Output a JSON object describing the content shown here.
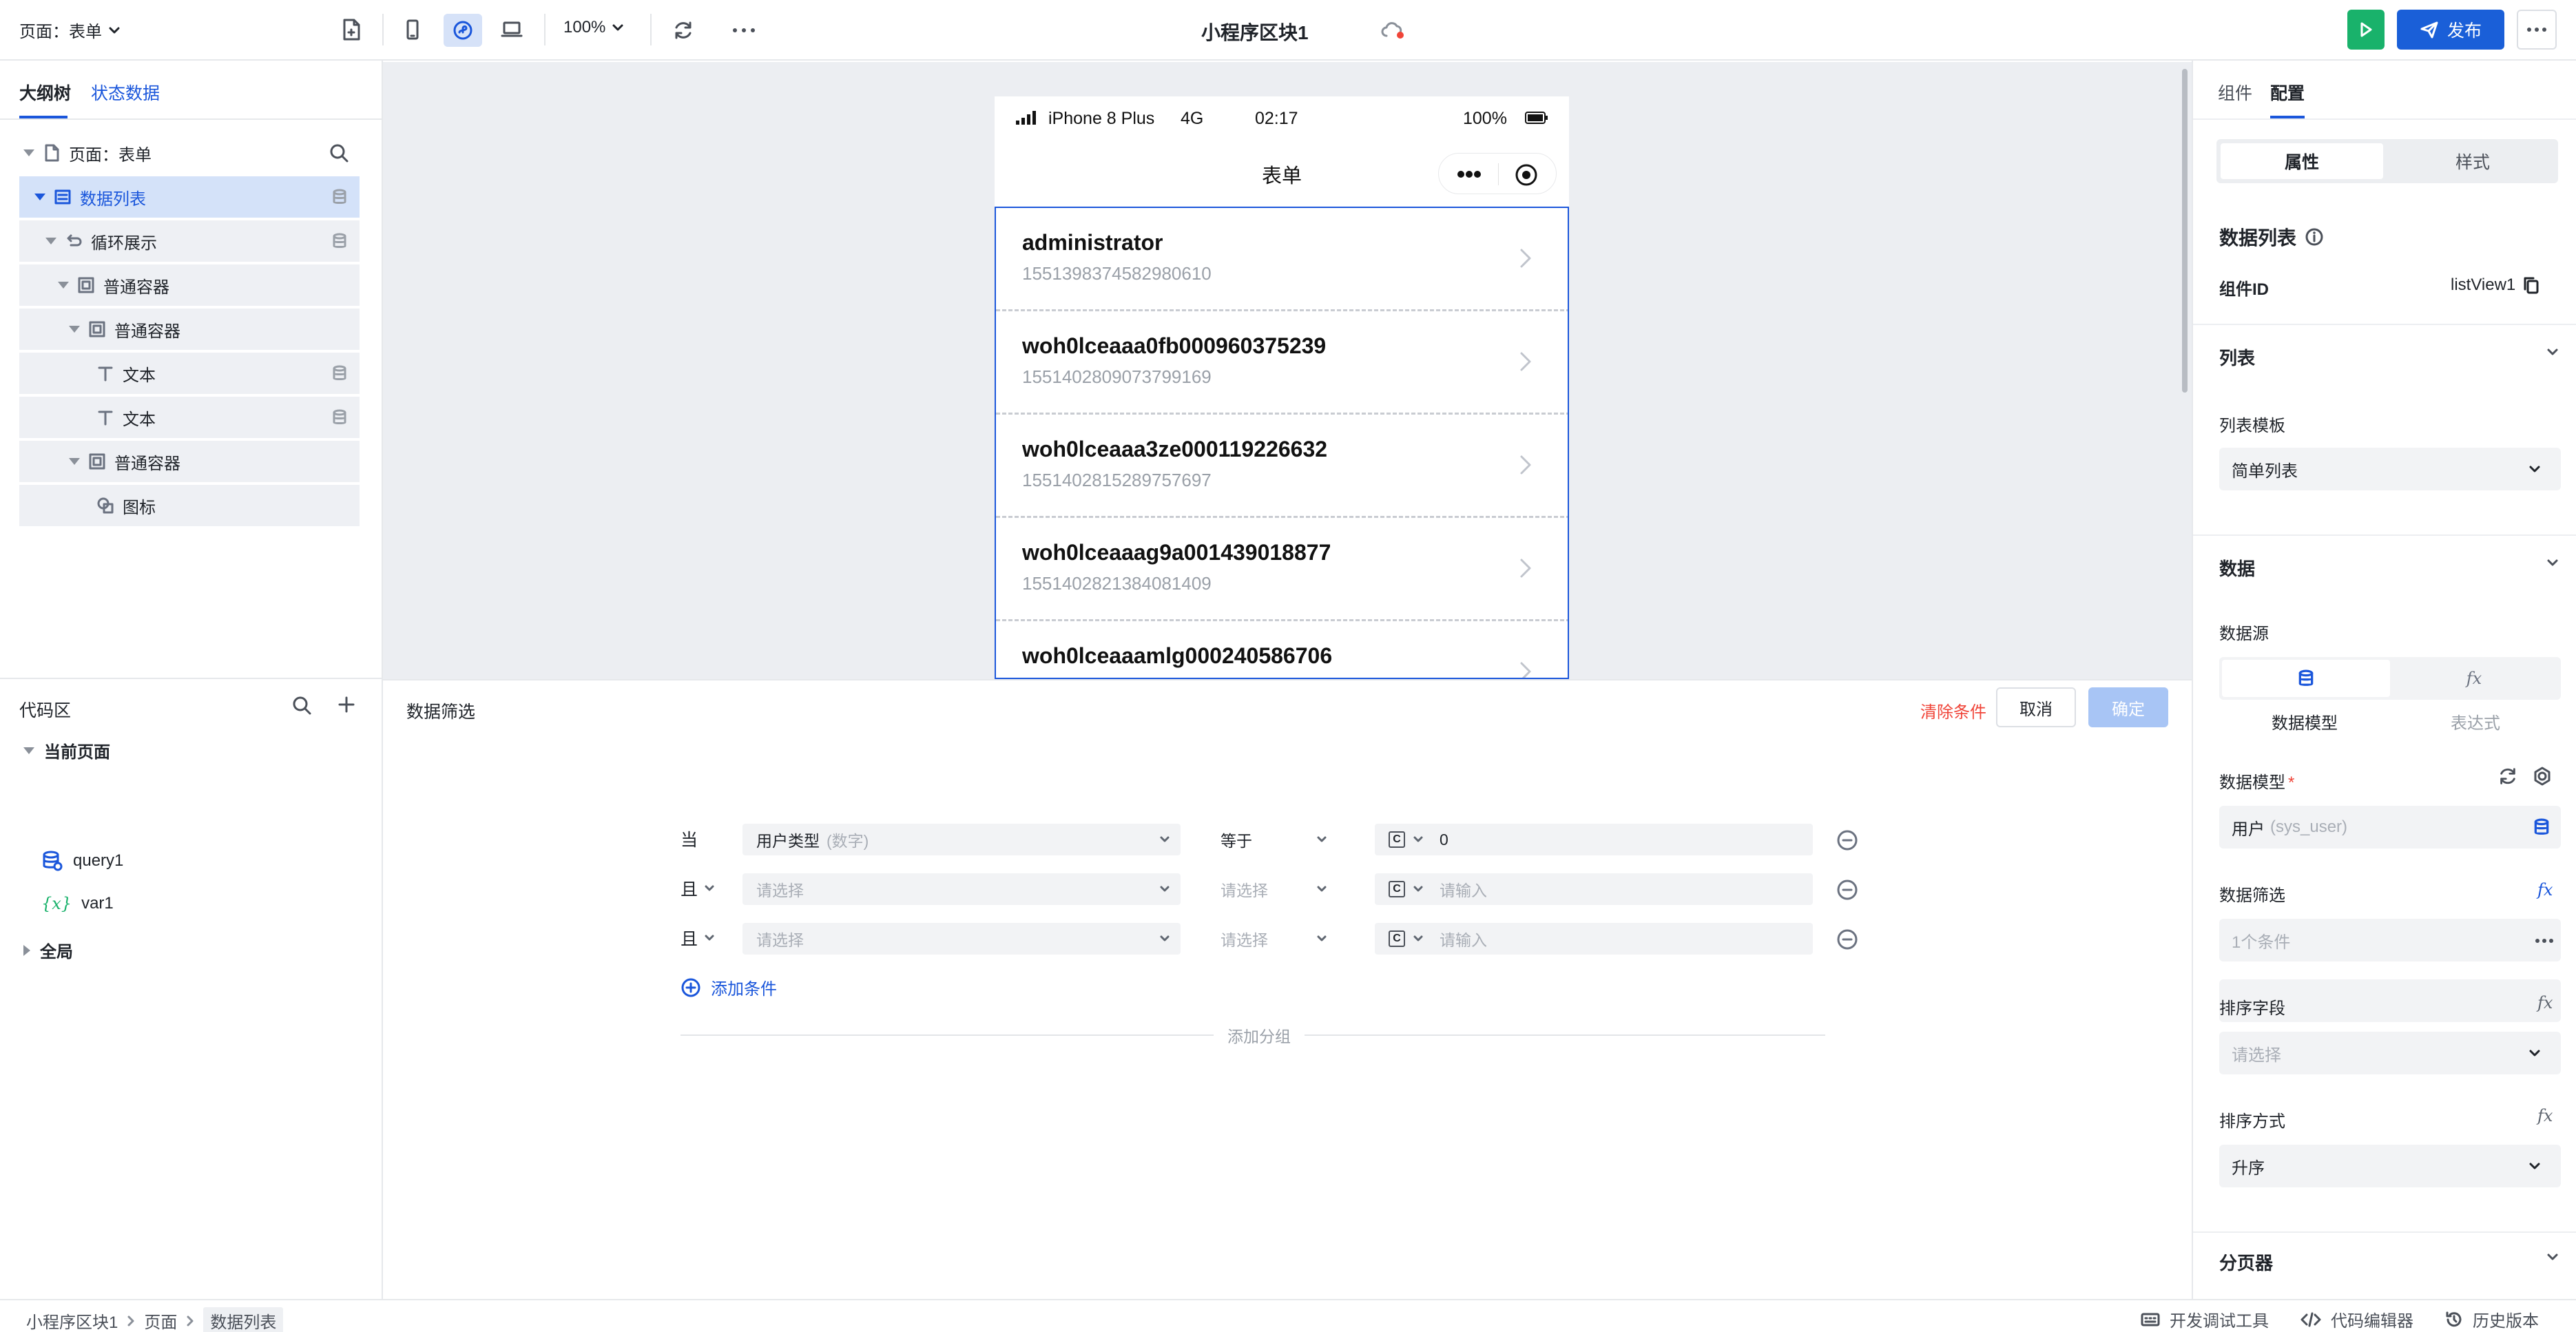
{
  "topbar": {
    "page_selector": "页面：表单",
    "zoom": "100%",
    "title": "小程序区块1",
    "publish_label": "发布"
  },
  "left": {
    "tabs": [
      "大纲树",
      "状态数据"
    ],
    "tree": [
      {
        "label": "页面：表单"
      },
      {
        "label": "数据列表"
      },
      {
        "label": "循环展示"
      },
      {
        "label": "普通容器"
      },
      {
        "label": "普通容器"
      },
      {
        "label": "文本"
      },
      {
        "label": "文本"
      },
      {
        "label": "普通容器"
      },
      {
        "label": "图标"
      }
    ],
    "code_title": "代码区",
    "code_items": {
      "current_page": "当前页面",
      "query": "query1",
      "var": "var1",
      "global": "全局"
    }
  },
  "phone": {
    "carrier": "iPhone 8 Plus",
    "network": "4G",
    "time": "02:17",
    "battery": "100%",
    "nav_title": "表单",
    "items": [
      {
        "title": "administrator",
        "sub": "1551398374582980610"
      },
      {
        "title": "woh0lceaaa0fb000960375239",
        "sub": "1551402809073799169"
      },
      {
        "title": "woh0lceaaa3ze000119226632",
        "sub": "1551402815289757697"
      },
      {
        "title": "woh0lceaaag9a001439018877",
        "sub": "1551402821384081409"
      },
      {
        "title": "woh0lceaaamlg000240586706",
        "sub": ""
      }
    ]
  },
  "filter": {
    "title": "数据筛选",
    "clear_label": "清除条件",
    "cancel_label": "取消",
    "confirm_label": "确定",
    "rows": [
      {
        "logic": "当",
        "field": "用户类型",
        "field_type": "(数字)",
        "op": "等于",
        "value": "0"
      },
      {
        "logic": "且",
        "field": "请选择",
        "field_type": "",
        "op": "请选择",
        "value": "请输入"
      },
      {
        "logic": "且",
        "field": "请选择",
        "field_type": "",
        "op": "请选择",
        "value": "请输入"
      }
    ],
    "add_condition": "添加条件",
    "add_group": "添加分组"
  },
  "right": {
    "tabs": [
      "组件",
      "配置"
    ],
    "segments": [
      "属性",
      "样式"
    ],
    "component_title": "数据列表",
    "component_id_label": "组件ID",
    "component_id": "listView1",
    "section_list": "列表",
    "list_template_label": "列表模板",
    "list_template": "简单列表",
    "section_data": "数据",
    "source_label": "数据源",
    "source_options": [
      "数据模型",
      "表达式"
    ],
    "model_label": "数据模型",
    "model_value": "用户",
    "model_key": "(sys_user)",
    "filter_label": "数据筛选",
    "filter_value": "1个条件",
    "sort_field_label": "排序字段",
    "sort_field_value": "请选择",
    "sort_order_label": "排序方式",
    "sort_order_value": "升序",
    "section_pager": "分页器"
  },
  "status": {
    "breadcrumb": [
      "小程序区块1",
      "页面",
      "数据列表"
    ],
    "debug_tools": "开发调试工具",
    "code_editor": "代码编辑器",
    "history": "历史版本"
  },
  "colors": {
    "accent": "#1a56db",
    "publish": "#1a5fd8",
    "run": "#19b26b",
    "danger": "#f04438"
  }
}
